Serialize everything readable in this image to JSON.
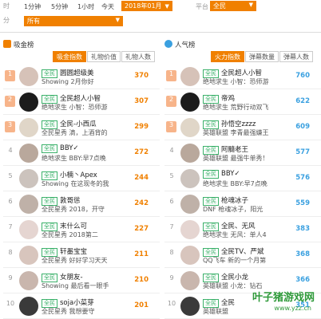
{
  "filters": {
    "label_time": "时",
    "time_options": [
      "1分钟",
      "5分钟",
      "1小时",
      "今天"
    ],
    "date_value": "2018年01月",
    "label_platform": "平台",
    "platform_value": "全民",
    "label_category": "分",
    "category_value": "所有"
  },
  "left_panel": {
    "title": "吸金榜",
    "tabs": [
      "吸金指数",
      "礼物价值",
      "礼物人数"
    ],
    "items": [
      {
        "rank": "1",
        "badge": "全民",
        "name": "圆圆超级美",
        "sub": "Showing 2月你好",
        "score": "370"
      },
      {
        "rank": "2",
        "badge": "全民",
        "name": "全民超人小智",
        "sub": "绝地求生 小智：恐师游",
        "score": "307"
      },
      {
        "rank": "3",
        "badge": "全民",
        "name": "全民-小西瓜",
        "sub": "全民星秀 滴，上酒背的",
        "score": "299"
      },
      {
        "rank": "4",
        "badge": "全民",
        "name": "BBY✓",
        "sub": "绝地求生 BBY:早7点晚",
        "score": "272"
      },
      {
        "rank": "5",
        "badge": "全民",
        "name": "小楠丶Apex",
        "sub": "Showing 在这现冬的我",
        "score": "244"
      },
      {
        "rank": "6",
        "badge": "全民",
        "name": "敦哥慫",
        "sub": "全民星秀 2018，开守",
        "score": "242"
      },
      {
        "rank": "7",
        "badge": "全民",
        "name": "末什么可",
        "sub": "全民星秀 2018第二",
        "score": "227"
      },
      {
        "rank": "8",
        "badge": "全民",
        "name": "轩墨宝宝",
        "sub": "全民星秀 好好学习天天",
        "score": "211"
      },
      {
        "rank": "9",
        "badge": "全民",
        "name": "女朋友-",
        "sub": "Showing 最后看一眼手",
        "score": "210"
      },
      {
        "rank": "10",
        "badge": "全民",
        "name": "soja小菜芽",
        "sub": "全民星秀 我想要守",
        "score": "201"
      }
    ]
  },
  "right_panel": {
    "title": "人气榜",
    "tabs": [
      "火力指数",
      "弹幕数量",
      "弹幕人数"
    ],
    "items": [
      {
        "rank": "1",
        "badge": "全民",
        "name": "全民超人小智",
        "sub": "绝地求生 小智：恐师游",
        "score": "760"
      },
      {
        "rank": "2",
        "badge": "全民",
        "name": "帝鸡",
        "sub": "绝地求生 荒野行动双飞",
        "score": "622"
      },
      {
        "rank": "3",
        "badge": "全民",
        "name": "孙悟空zzzz",
        "sub": "英雄联盟 李青最强嫌王",
        "score": "609"
      },
      {
        "rank": "4",
        "badge": "全民",
        "name": "阿髓老王",
        "sub": "英雄联盟 最强牛单秀！",
        "score": "577"
      },
      {
        "rank": "5",
        "badge": "全民",
        "name": "BBY✓",
        "sub": "绝地求生 BBY:早7点晚",
        "score": "576"
      },
      {
        "rank": "6",
        "badge": "全民",
        "name": "枪魂冰子",
        "sub": "DNF 枪魂冰子，阳光",
        "score": "559"
      },
      {
        "rank": "7",
        "badge": "全民",
        "name": "全民、无风",
        "sub": "绝地求生 无风：单人4",
        "score": "383"
      },
      {
        "rank": "8",
        "badge": "全民",
        "name": "全民TV、严斌",
        "sub": "QQ飞车 新的一个月第",
        "score": "368"
      },
      {
        "rank": "9",
        "badge": "全民",
        "name": "全民小龙",
        "sub": "英雄联盟 小龙：钻石",
        "score": "366"
      },
      {
        "rank": "10",
        "badge": "全民",
        "name": "全民",
        "sub": "英雄联盟",
        "score": "351"
      }
    ]
  },
  "watermark": {
    "title": "叶子猪游戏网",
    "url": "www.yzz.cn"
  },
  "colors": {
    "accent": "#f08000",
    "right_score": "#3aa0e0",
    "badge": "#3bb16a"
  }
}
